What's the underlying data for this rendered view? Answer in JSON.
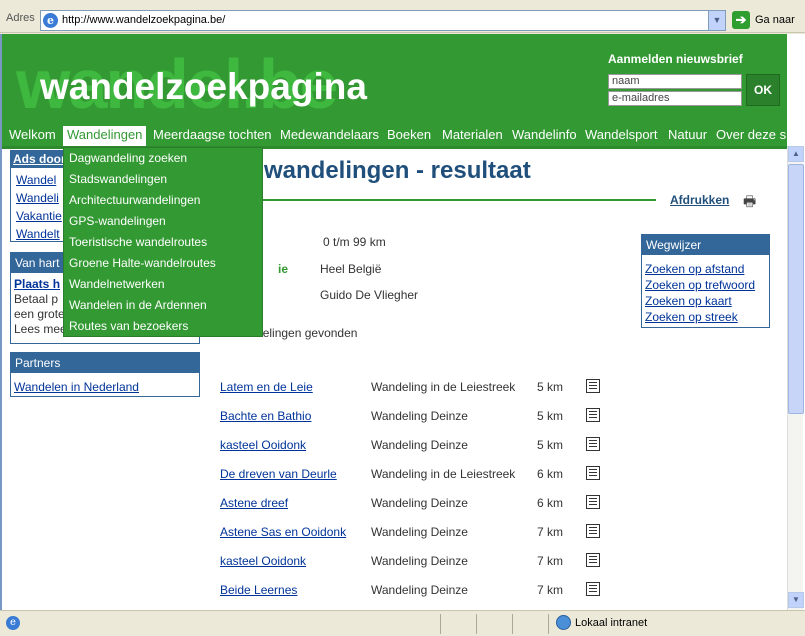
{
  "browser": {
    "address_label": "Adres",
    "url": "http://www.wandelzoekpagina.be/",
    "go_label": "Ga naar",
    "status_zone": "Lokaal intranet"
  },
  "header": {
    "logo_shadow": "wandel.be",
    "logo": "wandelzoekpagina",
    "newsletter_title": "Aanmelden nieuwsbrief",
    "name_placeholder": "naam",
    "email_placeholder": "e-mailadres",
    "ok_label": "OK"
  },
  "nav": {
    "items": [
      "Welkom",
      "Wandelingen",
      "Meerdaagse tochten",
      "Medewandelaars",
      "Boeken",
      "Materialen",
      "Wandelinfo",
      "Wandelsport",
      "Natuur",
      "Over deze site"
    ]
  },
  "dropdown": {
    "items": [
      "Dagwandeling zoeken",
      "Stadswandelingen",
      "Architectuurwandelingen",
      "GPS-wandelingen",
      "Toeristische wandelroutes",
      "Groene Halte-wandelroutes",
      "Wandelnetwerken",
      "Wandelen in de Ardennen",
      "Routes van bezoekers"
    ]
  },
  "sidebar": {
    "ads_title": "Ads door",
    "ads_links": [
      "Wandel",
      "Wandeli",
      "Vakantie",
      "Wandelt"
    ],
    "van_title": "Van hart",
    "van_heading": "Plaats h",
    "van_lines": [
      "Betaal p",
      "een grote",
      "Lees meer..."
    ],
    "partners_title": "Partners",
    "partners_link": "Wandelen in Nederland"
  },
  "main": {
    "title": "wandelingen - resultaat",
    "print_label": "Afdrukken",
    "criteria_distance": "0 t/m 99 km",
    "criteria_region_label": "ie",
    "criteria_region": "Heel België",
    "criteria_author": "Guido De Vliegher",
    "found_text": "wandelingen gevonden"
  },
  "wegwijzer": {
    "title": "Wegwijzer",
    "links": [
      "Zoeken op afstand",
      "Zoeken op trefwoord",
      "Zoeken op kaart",
      "Zoeken op streek"
    ]
  },
  "results": [
    {
      "name": "Latem en de Leie",
      "region": "Wandeling in de Leiestreek",
      "distance": "5 km"
    },
    {
      "name": "Bachte en Bathio",
      "region": "Wandeling Deinze",
      "distance": "5 km"
    },
    {
      "name": "kasteel Ooidonk",
      "region": "Wandeling Deinze",
      "distance": "5 km"
    },
    {
      "name": "De dreven van Deurle",
      "region": "Wandeling in de Leiestreek",
      "distance": "6 km"
    },
    {
      "name": "Astene dreef",
      "region": "Wandeling Deinze",
      "distance": "6 km"
    },
    {
      "name": "Astene Sas en Ooidonk",
      "region": "Wandeling Deinze",
      "distance": "7 km"
    },
    {
      "name": "kasteel Ooidonk",
      "region": "Wandeling Deinze",
      "distance": "7 km"
    },
    {
      "name": "Beide Leernes",
      "region": "Wandeling Deinze",
      "distance": "7 km"
    }
  ]
}
